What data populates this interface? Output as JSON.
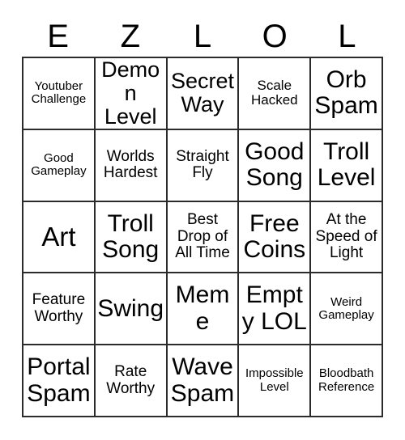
{
  "card": {
    "header_letters": [
      "E",
      "Z",
      "L",
      "O",
      "L"
    ],
    "rows": [
      [
        {
          "text": "Youtuber Challenge",
          "size": "xs"
        },
        {
          "text": "Demon Level",
          "size": "xl"
        },
        {
          "text": "Secret Way",
          "size": "xl"
        },
        {
          "text": "Scale Hacked",
          "size": "s"
        },
        {
          "text": "Orb Spam",
          "size": "xxl"
        }
      ],
      [
        {
          "text": "Good Gameplay",
          "size": "xs"
        },
        {
          "text": "Worlds Hardest",
          "size": "m"
        },
        {
          "text": "Straight Fly",
          "size": "m"
        },
        {
          "text": "Good Song",
          "size": "xxl"
        },
        {
          "text": "Troll Level",
          "size": "xxl"
        }
      ],
      [
        {
          "text": "Art",
          "size": "huge"
        },
        {
          "text": "Troll Song",
          "size": "xxl"
        },
        {
          "text": "Best Drop of All Time",
          "size": "m"
        },
        {
          "text": "Free Coins",
          "size": "xxl"
        },
        {
          "text": "At the Speed of Light",
          "size": "m"
        }
      ],
      [
        {
          "text": "Feature Worthy",
          "size": "m"
        },
        {
          "text": "Swing",
          "size": "xxl"
        },
        {
          "text": "Meme",
          "size": "xxl"
        },
        {
          "text": "Empty LOL",
          "size": "xxl"
        },
        {
          "text": "Weird Gameplay",
          "size": "xs"
        }
      ],
      [
        {
          "text": "Portal Spam",
          "size": "xxl"
        },
        {
          "text": "Rate Worthy",
          "size": "m"
        },
        {
          "text": "Wave Spam",
          "size": "xxl"
        },
        {
          "text": "Impossible Level",
          "size": "xs"
        },
        {
          "text": "Bloodbath Reference",
          "size": "xs"
        }
      ]
    ]
  },
  "colors": {
    "border": "#2b2b2b",
    "text": "#000000",
    "background": "#ffffff"
  }
}
